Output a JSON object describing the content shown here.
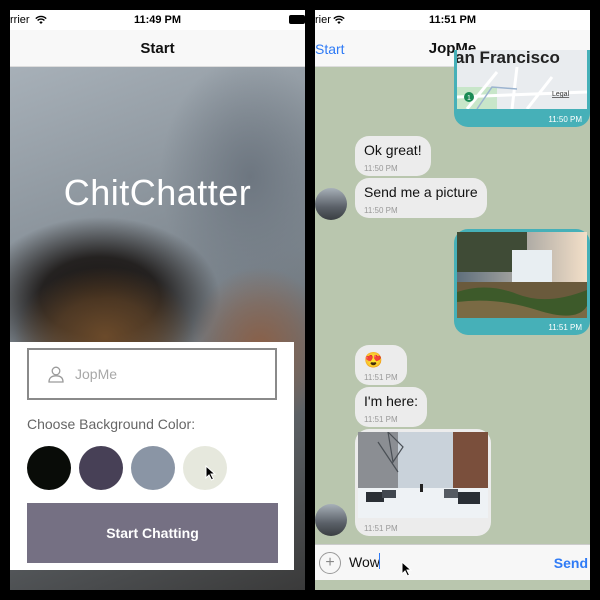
{
  "left": {
    "status": {
      "carrier": "rrier",
      "time": "11:49 PM"
    },
    "nav_title": "Start",
    "app_title": "ChitChatter",
    "name_input": {
      "placeholder": "JopMe",
      "value": ""
    },
    "color_label": "Choose Background Color:",
    "swatches": [
      "#090C08",
      "#474056",
      "#8A95A5",
      "#E6E8DD"
    ],
    "start_button": "Start Chatting"
  },
  "right": {
    "status": {
      "carrier": "rier",
      "time": "11:51 PM"
    },
    "back_label": "Start",
    "nav_title": "JopMe",
    "background": "#B9C6AE",
    "outgoing_color": "#46B0B8",
    "messages": [
      {
        "side": "out",
        "type": "location",
        "map_text": "an Francisco",
        "legal": "Legal",
        "pin": "1",
        "time": "11:50 PM"
      },
      {
        "side": "in",
        "type": "text",
        "text": "Ok great!",
        "time": "11:50 PM"
      },
      {
        "side": "in",
        "type": "text",
        "text": "Send me a picture",
        "time": "11:50 PM"
      },
      {
        "side": "out",
        "type": "image",
        "image": "waterfall-photo",
        "time": "11:51 PM"
      },
      {
        "side": "in",
        "type": "text",
        "text": "😍",
        "time": "11:51 PM"
      },
      {
        "side": "in",
        "type": "text",
        "text": "I'm here:",
        "time": "11:51 PM"
      },
      {
        "side": "in",
        "type": "image",
        "image": "snowy-street-photo",
        "time": "11:51 PM"
      }
    ],
    "compose_value": "Wow",
    "send_label": "Send"
  },
  "colors": {
    "accent_blue": "#2F7BF6",
    "start_button": "#757083"
  }
}
